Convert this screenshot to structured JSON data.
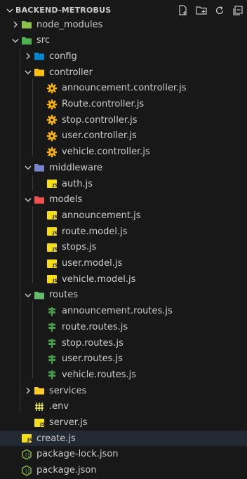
{
  "explorer": {
    "root_title": "BACKEND-METROBUS",
    "actions": [
      {
        "name": "new-file-icon"
      },
      {
        "name": "new-folder-icon"
      },
      {
        "name": "refresh-icon"
      },
      {
        "name": "collapse-all-icon"
      }
    ]
  },
  "tree": [
    {
      "label": "node_modules",
      "depth": 1,
      "type": "folder",
      "expanded": false,
      "icon": "folder-node-icon",
      "color": "#8bc34a"
    },
    {
      "label": "src",
      "depth": 1,
      "type": "folder",
      "expanded": true,
      "icon": "folder-src-icon",
      "color": "#4caf50"
    },
    {
      "label": "config",
      "depth": 2,
      "type": "folder",
      "expanded": false,
      "icon": "folder-config-icon",
      "color": "#0288d1"
    },
    {
      "label": "controller",
      "depth": 2,
      "type": "folder",
      "expanded": true,
      "icon": "folder-controller-icon",
      "color": "#ffc107"
    },
    {
      "label": "announcement.controller.js",
      "depth": 3,
      "type": "file",
      "icon": "gear-icon",
      "color": "#ffb300"
    },
    {
      "label": "Route.controller.js",
      "depth": 3,
      "type": "file",
      "icon": "gear-icon",
      "color": "#ffb300"
    },
    {
      "label": "stop.controller.js",
      "depth": 3,
      "type": "file",
      "icon": "gear-icon",
      "color": "#ffb300"
    },
    {
      "label": "user.controller.js",
      "depth": 3,
      "type": "file",
      "icon": "gear-icon",
      "color": "#ffb300"
    },
    {
      "label": "vehicle.controller.js",
      "depth": 3,
      "type": "file",
      "icon": "gear-icon",
      "color": "#ffb300"
    },
    {
      "label": "middleware",
      "depth": 2,
      "type": "folder",
      "expanded": true,
      "icon": "folder-middleware-icon",
      "color": "#7986cb"
    },
    {
      "label": "auth.js",
      "depth": 3,
      "type": "file",
      "icon": "js-file-icon",
      "color": "#f5de19"
    },
    {
      "label": "models",
      "depth": 2,
      "type": "folder",
      "expanded": true,
      "icon": "folder-models-icon",
      "color": "#ef5350"
    },
    {
      "label": "announcement.js",
      "depth": 3,
      "type": "file",
      "icon": "js-file-icon",
      "color": "#f5de19"
    },
    {
      "label": "route.model.js",
      "depth": 3,
      "type": "file",
      "icon": "js-file-icon",
      "color": "#f5de19"
    },
    {
      "label": "stops.js",
      "depth": 3,
      "type": "file",
      "icon": "js-file-icon",
      "color": "#f5de19"
    },
    {
      "label": "user.model.js",
      "depth": 3,
      "type": "file",
      "icon": "js-file-icon",
      "color": "#f5de19"
    },
    {
      "label": "vehicle.model.js",
      "depth": 3,
      "type": "file",
      "icon": "js-file-icon",
      "color": "#f5de19"
    },
    {
      "label": "routes",
      "depth": 2,
      "type": "folder",
      "expanded": true,
      "icon": "folder-routes-icon",
      "color": "#66bb6a"
    },
    {
      "label": "announcement.routes.js",
      "depth": 3,
      "type": "file",
      "icon": "signpost-icon",
      "color": "#43a047"
    },
    {
      "label": "route.routes.js",
      "depth": 3,
      "type": "file",
      "icon": "signpost-icon",
      "color": "#43a047"
    },
    {
      "label": "stop.routes.js",
      "depth": 3,
      "type": "file",
      "icon": "signpost-icon",
      "color": "#43a047"
    },
    {
      "label": "user.routes.js",
      "depth": 3,
      "type": "file",
      "icon": "signpost-icon",
      "color": "#43a047"
    },
    {
      "label": "vehicle.routes.js",
      "depth": 3,
      "type": "file",
      "icon": "signpost-icon",
      "color": "#43a047"
    },
    {
      "label": "services",
      "depth": 2,
      "type": "folder",
      "expanded": false,
      "icon": "folder-services-icon",
      "color": "#ffca28"
    },
    {
      "label": ".env",
      "depth": 2,
      "type": "file",
      "icon": "env-file-icon",
      "color": "#faf743"
    },
    {
      "label": "server.js",
      "depth": 2,
      "type": "file",
      "icon": "js-file-icon",
      "color": "#f5de19"
    },
    {
      "label": "create.js",
      "depth": 1,
      "type": "file",
      "icon": "js-file-icon",
      "color": "#f5de19",
      "selected": true
    },
    {
      "label": "package-lock.json",
      "depth": 1,
      "type": "file",
      "icon": "npm-json-icon",
      "color": "#8bc34a"
    },
    {
      "label": "package.json",
      "depth": 1,
      "type": "file",
      "icon": "npm-json-icon",
      "color": "#8bc34a"
    }
  ]
}
